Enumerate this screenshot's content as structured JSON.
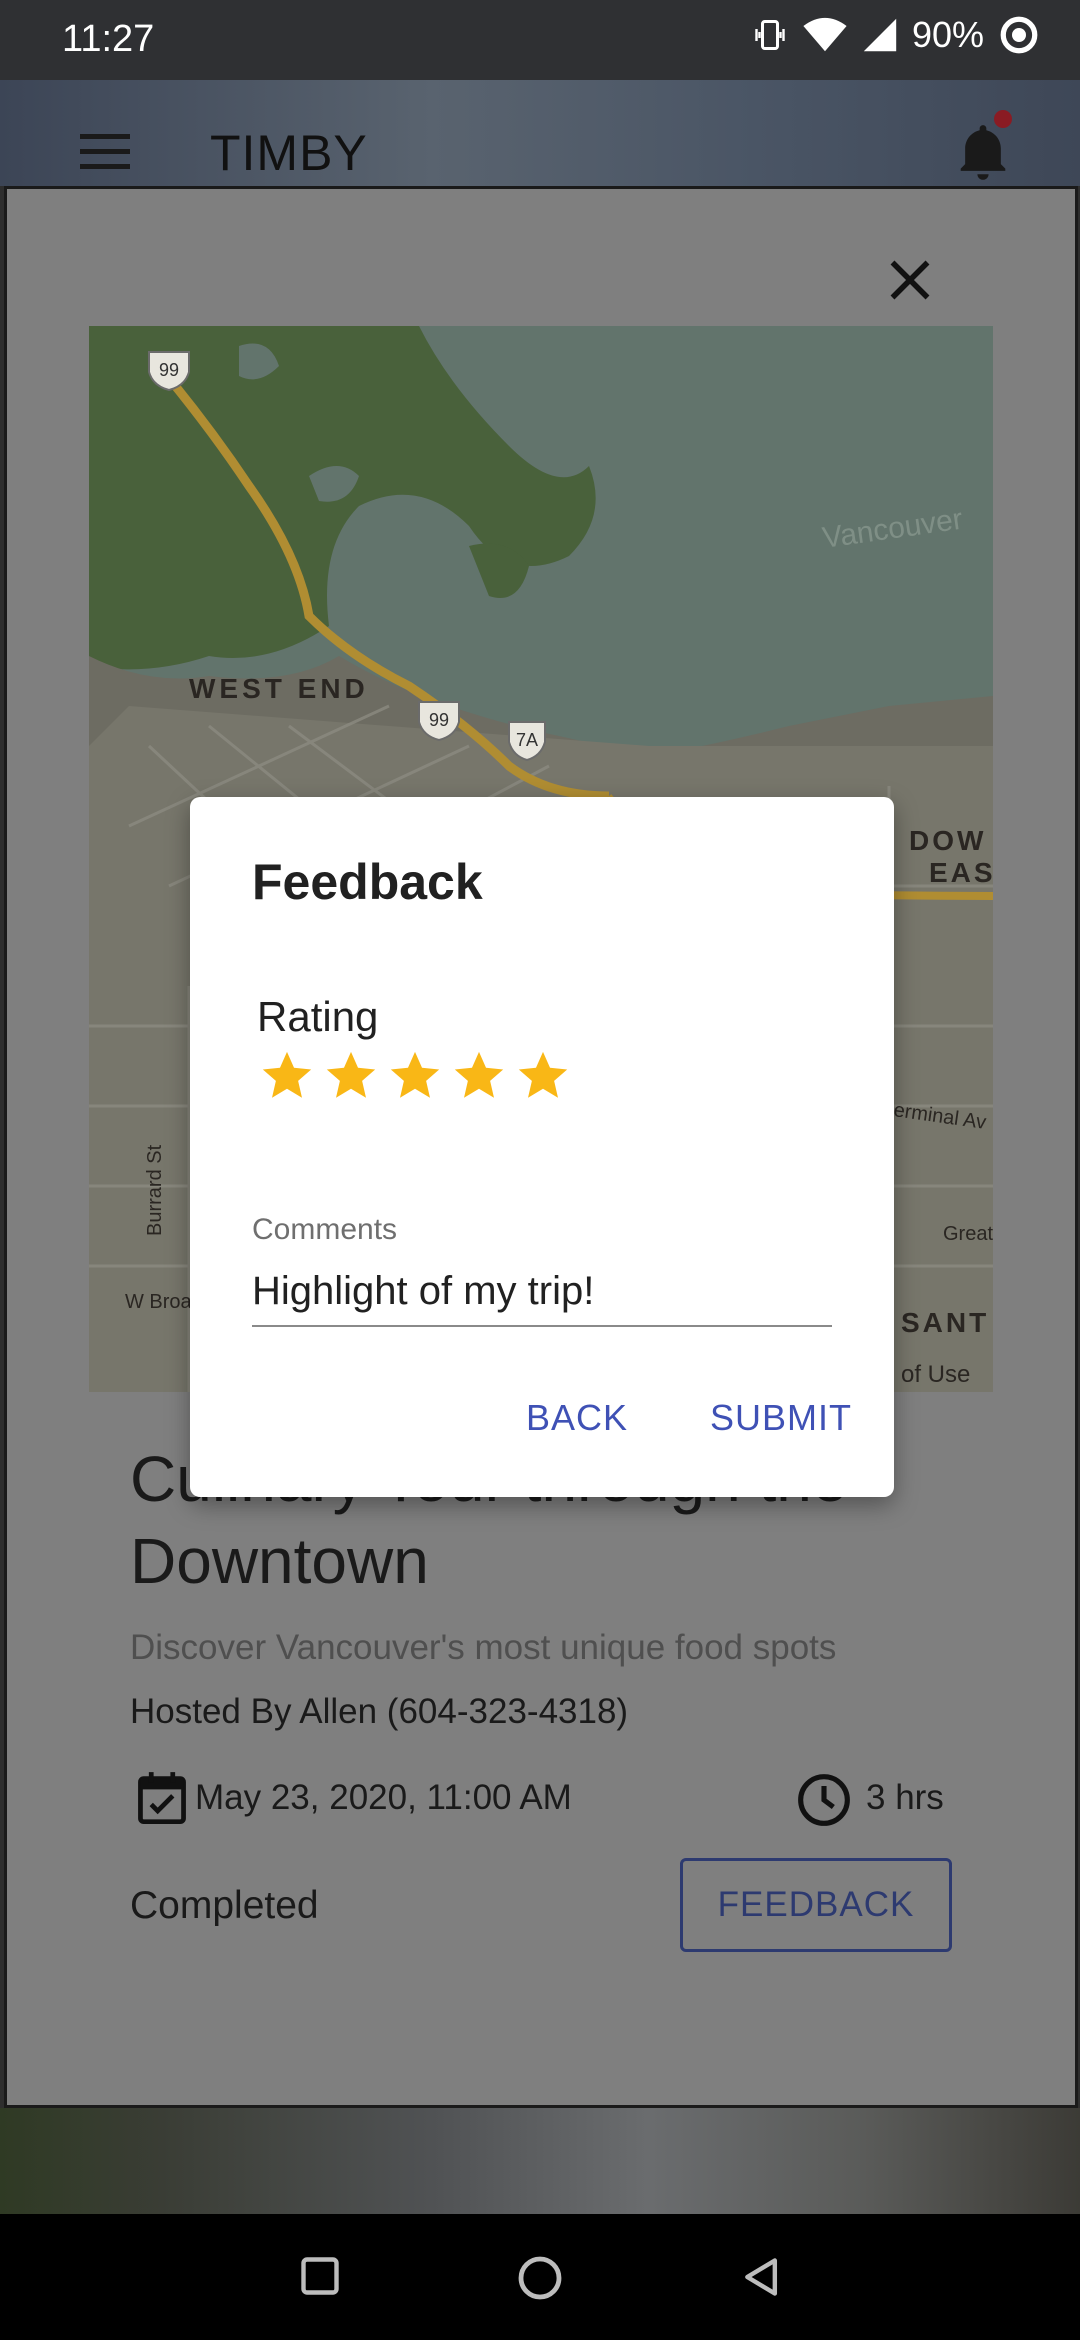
{
  "status_bar": {
    "time": "11:27",
    "battery": "90%"
  },
  "app_bar": {
    "title": "TIMBY"
  },
  "map": {
    "labels": {
      "west_end": "WEST END",
      "vancouver": "Vancouver",
      "downtown_east": "DOW",
      "downtown_east_2": "EAS",
      "burrard": "Burrard St",
      "w_broadway": "W Broa",
      "terminal": "erminal Av",
      "great": "Great",
      "sant": "SANT",
      "terms": "of Use",
      "hwy_99": "99",
      "hwy_7a": "7A"
    }
  },
  "tour": {
    "title": "Culinary Tour through the Downtown",
    "subtitle": "Discover Vancouver's most unique food spots",
    "host": "Hosted By Allen (604-323-4318)",
    "date": "May 23, 2020, 11:00 AM",
    "duration": "3 hrs",
    "status": "Completed",
    "feedback_label": "FEEDBACK"
  },
  "dialog": {
    "title": "Feedback",
    "rating_label": "Rating",
    "rating": 5,
    "rating_max": 5,
    "comments_label": "Comments",
    "comments_value": "Highlight of my trip!",
    "back_label": "BACK",
    "submit_label": "SUBMIT"
  },
  "colors": {
    "accent": "#3f51b5",
    "star": "#f9b716",
    "notification": "#8a1b23"
  }
}
